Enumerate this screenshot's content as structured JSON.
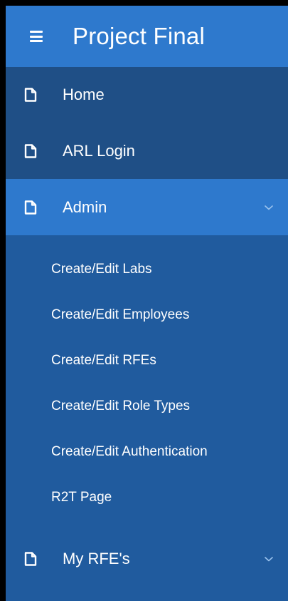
{
  "header": {
    "title": "Project Final",
    "menu_icon": "hamburger-menu-icon"
  },
  "nav": {
    "items": [
      {
        "label": "Home",
        "icon": "page-icon",
        "state": "default"
      },
      {
        "label": "ARL Login",
        "icon": "page-icon",
        "state": "default"
      },
      {
        "label": "Admin",
        "icon": "page-icon",
        "state": "expanded",
        "chevron": "chevron-down-icon"
      },
      {
        "label": "My RFE's",
        "icon": "page-icon",
        "state": "collapsed",
        "chevron": "chevron-down-icon"
      }
    ],
    "admin_submenu": [
      {
        "label": "Create/Edit Labs"
      },
      {
        "label": "Create/Edit Employees"
      },
      {
        "label": "Create/Edit RFEs"
      },
      {
        "label": "Create/Edit Role Types"
      },
      {
        "label": "Create/Edit Authentication"
      },
      {
        "label": "R2T Page"
      }
    ]
  },
  "colors": {
    "background": "#000000",
    "header": "#2e79cd",
    "nav_item": "#1f4f86",
    "active_item": "#2e79cd",
    "submenu": "#205b9e",
    "text": "#ffffff"
  }
}
